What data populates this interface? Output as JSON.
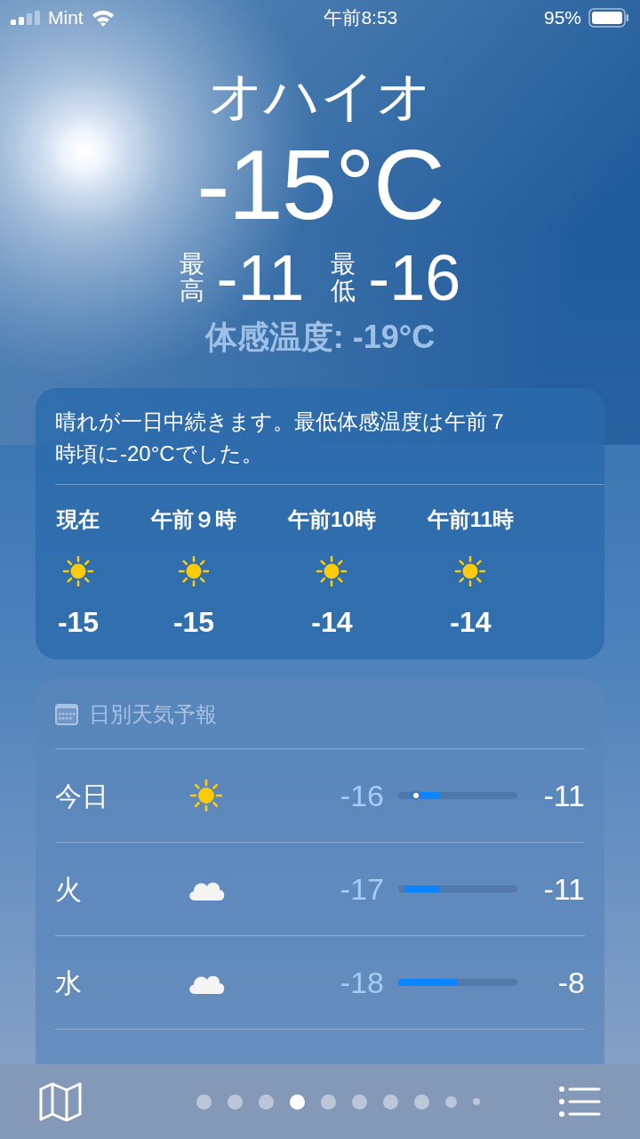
{
  "status_bar": {
    "carrier": "Mint",
    "time": "午前8:53",
    "battery": "95%"
  },
  "current": {
    "city": "オハイオ",
    "temperature": "-15°C",
    "high_label": "最高",
    "high": "-11",
    "low_label": "最低",
    "low": "-16",
    "feels_like": "体感温度: -19°C"
  },
  "hourly": {
    "summary": "晴れが一日中続きます。最低体感温度は午前７時頃に-20°Cでした。",
    "items": [
      {
        "time": "現在",
        "kind": "sun",
        "temp": "-15"
      },
      {
        "time": "午前９時",
        "kind": "sun",
        "temp": "-15"
      },
      {
        "time": "午前10時",
        "kind": "sun",
        "temp": "-14"
      },
      {
        "time": "午前11時",
        "kind": "sun",
        "temp": "-14"
      }
    ]
  },
  "daily": {
    "title": "日別天気予報",
    "rows": [
      {
        "day": "今日",
        "kind": "sun",
        "low": "-16",
        "high": "-11",
        "current_marker": true
      },
      {
        "day": "火",
        "kind": "cloud",
        "low": "-17",
        "high": "-11",
        "current_marker": false
      },
      {
        "day": "水",
        "kind": "cloud",
        "low": "-18",
        "high": "-8",
        "current_marker": false
      }
    ]
  },
  "page_dots": [
    {
      "kind": "normal",
      "selected": false
    },
    {
      "kind": "normal",
      "selected": false
    },
    {
      "kind": "normal",
      "selected": false
    },
    {
      "kind": "normal",
      "selected": true
    },
    {
      "kind": "normal",
      "selected": false
    },
    {
      "kind": "normal",
      "selected": false
    },
    {
      "kind": "normal",
      "selected": false
    },
    {
      "kind": "normal",
      "selected": false
    },
    {
      "kind": "small",
      "selected": false
    },
    {
      "kind": "tiny",
      "selected": false
    }
  ]
}
